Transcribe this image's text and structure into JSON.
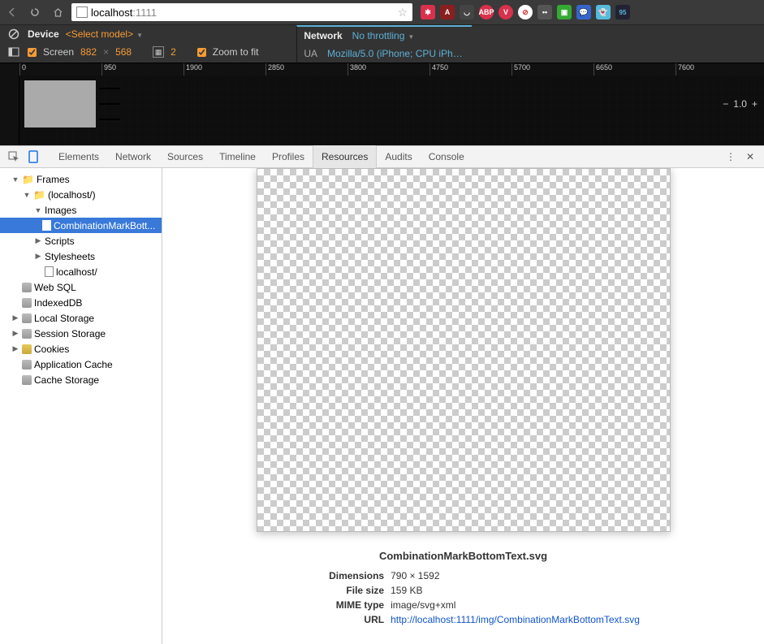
{
  "url": {
    "host": "localhost",
    "port": ":1111"
  },
  "device_bar": {
    "device_label": "Device",
    "model_placeholder": "<Select model>",
    "screen_label": "Screen",
    "width": "882",
    "height": "568",
    "dpr": "2",
    "zoom_fit": "Zoom to fit",
    "network_label": "Network",
    "throttling": "No throttling",
    "ua_label": "UA",
    "ua_value": "Mozilla/5.0 (iPhone; CPU iPhon..."
  },
  "ruler": [
    "0",
    "950",
    "1900",
    "2850",
    "3800",
    "4750",
    "5700",
    "6650",
    "7600"
  ],
  "zoom_level": "1.0",
  "devtools_tabs": [
    "Elements",
    "Network",
    "Sources",
    "Timeline",
    "Profiles",
    "Resources",
    "Audits",
    "Console"
  ],
  "devtools_active": "Resources",
  "tree": {
    "frames": "Frames",
    "localhost": "(localhost/)",
    "images": "Images",
    "selected_file": "CombinationMarkBott...",
    "scripts": "Scripts",
    "stylesheets": "Stylesheets",
    "localhost2": "localhost/",
    "websql": "Web SQL",
    "indexeddb": "IndexedDB",
    "localstorage": "Local Storage",
    "sessionstorage": "Session Storage",
    "cookies": "Cookies",
    "appcache": "Application Cache",
    "cachestorage": "Cache Storage"
  },
  "preview": {
    "title": "CombinationMarkBottomText.svg",
    "dimensions_k": "Dimensions",
    "dimensions_v": "790 × 1592",
    "filesize_k": "File size",
    "filesize_v": "159 KB",
    "mime_k": "MIME type",
    "mime_v": "image/svg+xml",
    "url_k": "URL",
    "url_v": "http://localhost:1111/img/CombinationMarkBottomText.svg"
  }
}
